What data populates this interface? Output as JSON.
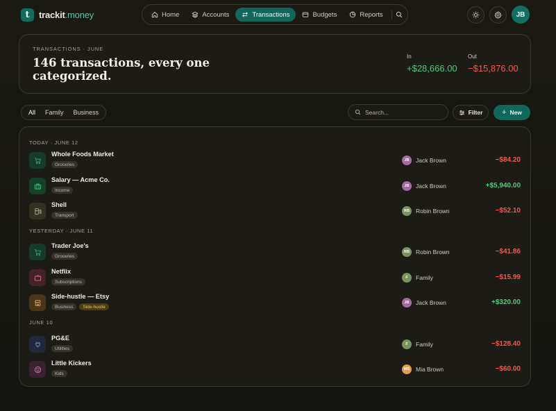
{
  "brand": {
    "logo_glyph": "t",
    "name": "trackit",
    "tld": ".money"
  },
  "nav": {
    "items": [
      {
        "label": "Home",
        "icon": "home-icon"
      },
      {
        "label": "Accounts",
        "icon": "layers-icon"
      },
      {
        "label": "Transactions",
        "icon": "arrows-swap-icon",
        "active": true
      },
      {
        "label": "Budgets",
        "icon": "wallet-icon"
      },
      {
        "label": "Reports",
        "icon": "pie-chart-icon"
      }
    ],
    "search_icon": "search-icon"
  },
  "top_right": {
    "theme_icon": "sun-icon",
    "settings_icon": "gear-icon",
    "user_initials": "JB",
    "user_avatar_color": "#127060"
  },
  "hero": {
    "eyebrow": "TRANSACTIONS · JUNE",
    "title": "146 transactions, every one categorized.",
    "in_label": "In",
    "in_value": "+$28,666.00",
    "out_label": "Out",
    "out_value": "−$15,876.00"
  },
  "toolbar": {
    "segments": [
      "All",
      "Family",
      "Business"
    ],
    "active_segment": "All",
    "search_placeholder": "Search...",
    "filter_label": "Filter",
    "new_label": "New",
    "new_glyph": "+"
  },
  "colors": {
    "accent": "#11685a",
    "positive": "#4ecb7a",
    "negative": "#ef5a4c"
  },
  "groups": [
    {
      "header": "TODAY · JUNE 12",
      "rows": [
        {
          "name": "Whole Foods Market",
          "tags": [
            "Groceries"
          ],
          "icon": "cart-icon",
          "icon_color": "#2f9b73",
          "icon_bg": "#163a2c",
          "person": "Jack Brown",
          "initials": "JB",
          "avatar_color": "#a86aa4",
          "amount": "−$84.20",
          "sign": "neg"
        },
        {
          "name": "Salary — Acme Co.",
          "tags": [
            "Income"
          ],
          "icon": "briefcase-icon",
          "icon_color": "#3bbf6b",
          "icon_bg": "#17402a",
          "person": "Jack Brown",
          "initials": "JB",
          "avatar_color": "#a86aa4",
          "amount": "+$5,940.00",
          "sign": "pos"
        },
        {
          "name": "Shell",
          "tags": [
            "Transport"
          ],
          "icon": "fuel-icon",
          "icon_color": "#a7a07e",
          "icon_bg": "#34321f",
          "person": "Robin Brown",
          "initials": "RB",
          "avatar_color": "#7a9460",
          "amount": "−$52.10",
          "sign": "neg"
        }
      ]
    },
    {
      "header": "YESTERDAY · JUNE 11",
      "rows": [
        {
          "name": "Trader Joe's",
          "tags": [
            "Groceries"
          ],
          "icon": "cart-icon",
          "icon_color": "#2f9b73",
          "icon_bg": "#163a2c",
          "person": "Robin Brown",
          "initials": "RB",
          "avatar_color": "#7a9460",
          "amount": "−$41.86",
          "sign": "neg"
        },
        {
          "name": "Netflix",
          "tags": [
            "Subscriptions"
          ],
          "icon": "tv-icon",
          "icon_color": "#d4606a",
          "icon_bg": "#43222a",
          "person": "Family",
          "initials": "F",
          "avatar_color": "#7a9460",
          "amount": "−$15.99",
          "sign": "neg"
        },
        {
          "name": "Side-hustle — Etsy",
          "tags": [
            "Business",
            "Side-hustle"
          ],
          "highlight_tag": "Side-hustle",
          "icon": "store-icon",
          "icon_color": "#e1a546",
          "icon_bg": "#4a3618",
          "person": "Jack Brown",
          "initials": "JB",
          "avatar_color": "#a86aa4",
          "amount": "+$320.00",
          "sign": "pos"
        }
      ]
    },
    {
      "header": "JUNE 10",
      "rows": [
        {
          "name": "PG&E",
          "tags": [
            "Utilities"
          ],
          "icon": "plug-icon",
          "icon_color": "#6f86b8",
          "icon_bg": "#22283c",
          "person": "Family",
          "initials": "F",
          "avatar_color": "#7a9460",
          "amount": "−$128.40",
          "sign": "neg"
        },
        {
          "name": "Little Kickers",
          "tags": [
            "Kids"
          ],
          "icon": "smiley-icon",
          "icon_color": "#c07a9a",
          "icon_bg": "#3b2232",
          "person": "Mia Brown",
          "initials": "MB",
          "avatar_color": "#e0a04a",
          "amount": "−$60.00",
          "sign": "neg"
        }
      ]
    }
  ]
}
